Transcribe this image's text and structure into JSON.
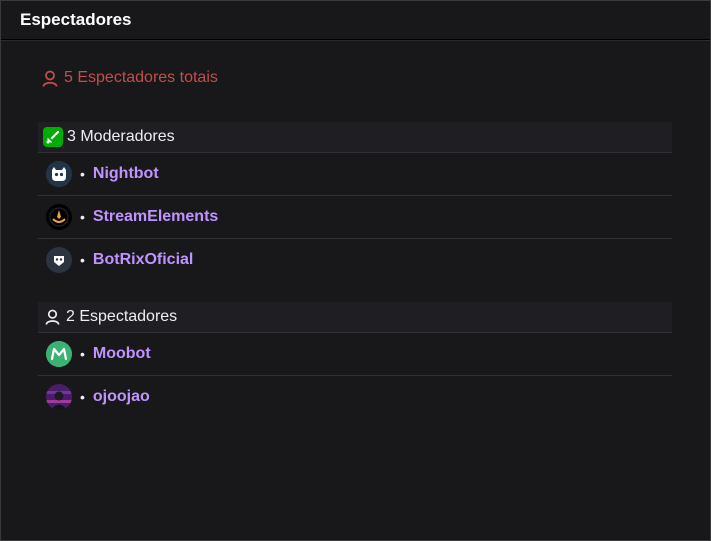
{
  "header": {
    "title": "Espectadores"
  },
  "total": {
    "label": "5 Espectadores totais",
    "icon": "user-icon",
    "color": "#c34e4b"
  },
  "moderators": {
    "label": "3 Moderadores",
    "icon": "sword-icon",
    "users": [
      {
        "name": "Nightbot",
        "avatar": "nightbot-avatar"
      },
      {
        "name": "StreamElements",
        "avatar": "streamelements-avatar"
      },
      {
        "name": "BotRixOficial",
        "avatar": "botrix-avatar"
      }
    ]
  },
  "viewers": {
    "label": "2 Espectadores",
    "icon": "user-icon",
    "users": [
      {
        "name": "Moobot",
        "avatar": "moobot-avatar"
      },
      {
        "name": "ojoojao",
        "avatar": "ojoojao-avatar"
      }
    ]
  },
  "bullet": "•",
  "colors": {
    "username": "#bf94ff",
    "moderator_badge": "#00ad03",
    "background": "#18181b"
  }
}
